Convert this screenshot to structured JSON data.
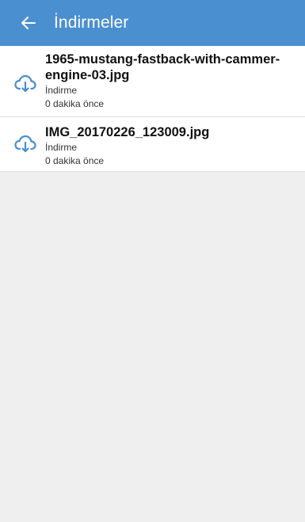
{
  "app_bar": {
    "back_icon": "arrow-left-icon",
    "title": "İndirmeler",
    "color": "#4a8fd0"
  },
  "downloads": [
    {
      "icon": "cloud-download-icon",
      "filename_line1": "1965-mustang-fastback-with-cammer-",
      "filename_line2": "engine-03.jpg",
      "type": "İndirme",
      "time": "0 dakika önce"
    },
    {
      "icon": "cloud-download-icon",
      "filename": "IMG_20170226_123009.jpg",
      "type": "İndirme",
      "time": "0 dakika önce"
    }
  ]
}
